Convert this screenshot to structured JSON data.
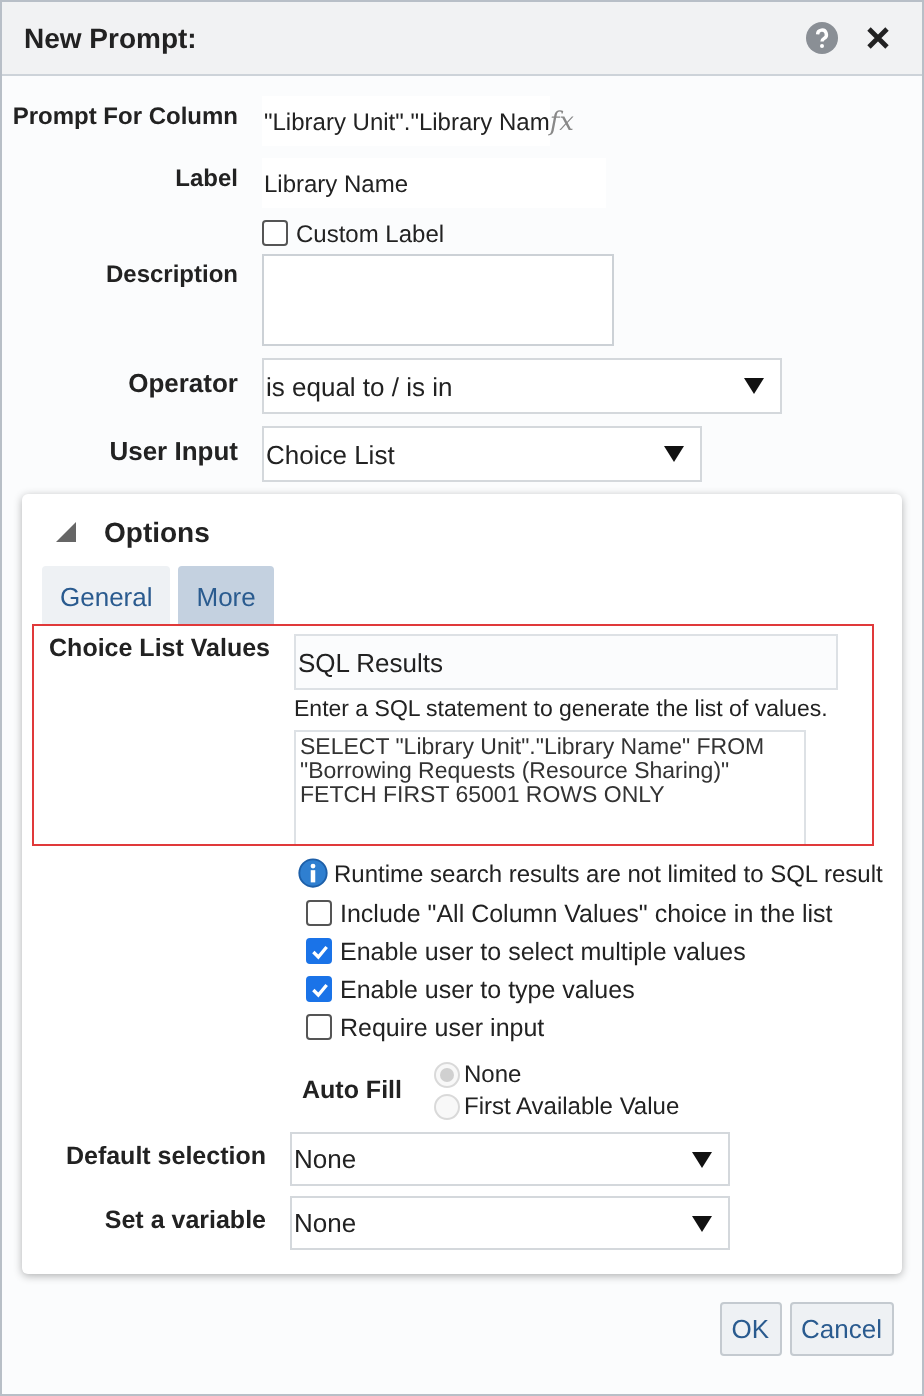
{
  "window": {
    "title": "New Prompt:"
  },
  "fields": [
    {
      "kind": "text",
      "label": "Prompt For Column",
      "value": "\"Library Unit\".\"Library Nam",
      "fx": "fx"
    },
    {
      "kind": "text",
      "label": "Label",
      "value": "Library Name"
    },
    {
      "kind": "checkbox",
      "label": "Custom Label",
      "checked": false
    },
    {
      "kind": "textarea",
      "label": "Description"
    },
    {
      "kind": "select",
      "label": "Operator",
      "value": "is equal to / is in"
    },
    {
      "kind": "select",
      "label": "User Input",
      "value": "Choice List"
    }
  ],
  "options": {
    "title": "Options",
    "expanded": true,
    "tabs": [
      {
        "label": "General",
        "selected": false
      },
      {
        "label": "More",
        "selected": true
      }
    ],
    "choice_list": {
      "label": "Choice List Values",
      "highlighted": true,
      "value": "SQL Results",
      "hint": "Enter a SQL statement to generate the list of values.",
      "sql": [
        "SELECT \"Library Unit\".\"Library Name\" FROM",
        "\"Borrowing Requests (Resource Sharing)\"",
        "FETCH FIRST 65001 ROWS ONLY"
      ]
    },
    "info": "Runtime search results are not limited to SQL result",
    "checkboxes": [
      {
        "label": "Include \"All Column Values\" choice in the list",
        "checked": false
      },
      {
        "label": "Enable user to select multiple values",
        "checked": true
      },
      {
        "label": "Enable user to type values",
        "checked": true
      },
      {
        "label": "Require user input",
        "checked": false
      }
    ],
    "auto_fill": {
      "label": "Auto Fill",
      "disabled": true,
      "radios": [
        {
          "label": "None",
          "selected": true
        },
        {
          "label": "First Available Value",
          "selected": false
        }
      ]
    },
    "selects": [
      {
        "label": "Default selection",
        "value": "None"
      },
      {
        "label": "Set a variable",
        "value": "None"
      }
    ]
  },
  "buttons": [
    "OK",
    "Cancel"
  ]
}
